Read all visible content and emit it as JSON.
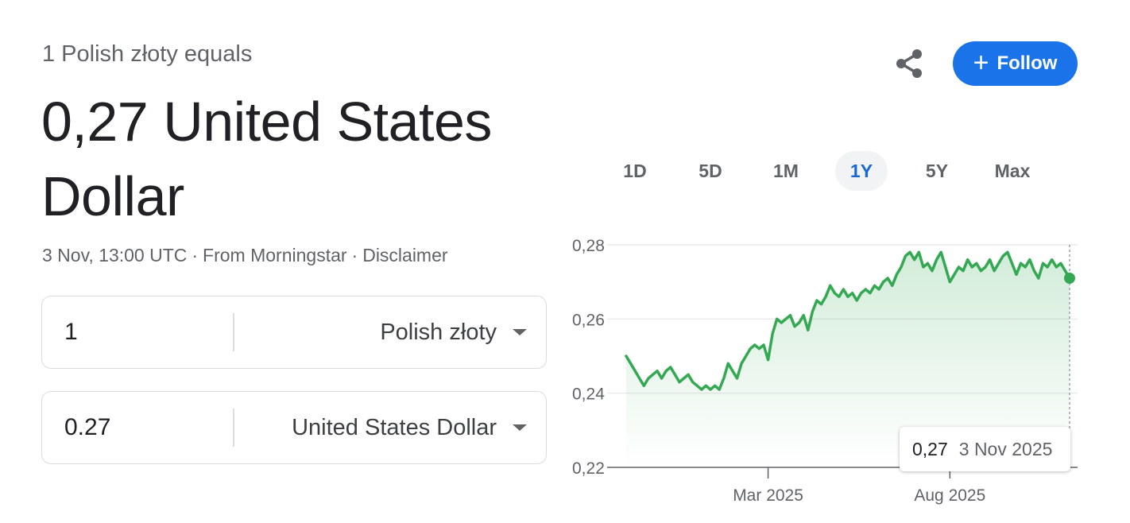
{
  "header": {
    "subtitle": "1 Polish złoty equals",
    "result": "0,27 United States Dollar"
  },
  "meta": {
    "timestamp": "3 Nov, 13:00 UTC",
    "source": "From Morningstar",
    "disclaimer": "Disclaimer",
    "separator": "·"
  },
  "converter": {
    "from": {
      "amount": "1",
      "currency": "Polish złoty"
    },
    "to": {
      "amount": "0.27",
      "currency": "United States Dollar"
    }
  },
  "actions": {
    "share_icon": "share-icon",
    "follow_label": "Follow",
    "follow_plus": "+"
  },
  "ranges": [
    {
      "label": "1D",
      "active": false
    },
    {
      "label": "5D",
      "active": false
    },
    {
      "label": "1M",
      "active": false
    },
    {
      "label": "1Y",
      "active": true
    },
    {
      "label": "5Y",
      "active": false
    },
    {
      "label": "Max",
      "active": false
    }
  ],
  "colors": {
    "line": "#34a853",
    "accent": "#1a73e8",
    "active_range": "#1967d2"
  },
  "tooltip": {
    "value": "0,27",
    "date": "3 Nov 2025"
  },
  "chart_data": {
    "type": "area",
    "title": "",
    "xlabel": "",
    "ylabel": "",
    "ylim": [
      0.22,
      0.28
    ],
    "yticks": [
      "0,28",
      "0,26",
      "0,24",
      "0,22"
    ],
    "xticks": [
      {
        "label": "Mar 2025",
        "t": 0.32
      },
      {
        "label": "Aug 2025",
        "t": 0.73
      }
    ],
    "grid": true,
    "legend": "none",
    "series": [
      {
        "points": [
          [
            0.0,
            0.25
          ],
          [
            0.01,
            0.248
          ],
          [
            0.02,
            0.246
          ],
          [
            0.03,
            0.244
          ],
          [
            0.04,
            0.242
          ],
          [
            0.05,
            0.244
          ],
          [
            0.06,
            0.245
          ],
          [
            0.07,
            0.246
          ],
          [
            0.08,
            0.244
          ],
          [
            0.09,
            0.246
          ],
          [
            0.1,
            0.247
          ],
          [
            0.11,
            0.245
          ],
          [
            0.12,
            0.243
          ],
          [
            0.13,
            0.244
          ],
          [
            0.14,
            0.245
          ],
          [
            0.15,
            0.243
          ],
          [
            0.16,
            0.242
          ],
          [
            0.17,
            0.241
          ],
          [
            0.18,
            0.242
          ],
          [
            0.19,
            0.241
          ],
          [
            0.2,
            0.242
          ],
          [
            0.21,
            0.241
          ],
          [
            0.22,
            0.244
          ],
          [
            0.23,
            0.248
          ],
          [
            0.24,
            0.246
          ],
          [
            0.25,
            0.244
          ],
          [
            0.26,
            0.248
          ],
          [
            0.27,
            0.25
          ],
          [
            0.28,
            0.252
          ],
          [
            0.29,
            0.253
          ],
          [
            0.3,
            0.252
          ],
          [
            0.31,
            0.253
          ],
          [
            0.32,
            0.249
          ],
          [
            0.33,
            0.256
          ],
          [
            0.34,
            0.26
          ],
          [
            0.35,
            0.259
          ],
          [
            0.36,
            0.26
          ],
          [
            0.37,
            0.261
          ],
          [
            0.38,
            0.258
          ],
          [
            0.39,
            0.259
          ],
          [
            0.4,
            0.261
          ],
          [
            0.41,
            0.257
          ],
          [
            0.42,
            0.262
          ],
          [
            0.43,
            0.265
          ],
          [
            0.44,
            0.264
          ],
          [
            0.45,
            0.266
          ],
          [
            0.46,
            0.269
          ],
          [
            0.47,
            0.267
          ],
          [
            0.48,
            0.266
          ],
          [
            0.49,
            0.268
          ],
          [
            0.5,
            0.266
          ],
          [
            0.51,
            0.267
          ],
          [
            0.52,
            0.265
          ],
          [
            0.53,
            0.267
          ],
          [
            0.54,
            0.268
          ],
          [
            0.55,
            0.267
          ],
          [
            0.56,
            0.269
          ],
          [
            0.57,
            0.268
          ],
          [
            0.58,
            0.27
          ],
          [
            0.59,
            0.271
          ],
          [
            0.6,
            0.269
          ],
          [
            0.61,
            0.272
          ],
          [
            0.62,
            0.274
          ],
          [
            0.63,
            0.277
          ],
          [
            0.64,
            0.278
          ],
          [
            0.65,
            0.276
          ],
          [
            0.66,
            0.278
          ],
          [
            0.67,
            0.274
          ],
          [
            0.68,
            0.275
          ],
          [
            0.69,
            0.273
          ],
          [
            0.7,
            0.276
          ],
          [
            0.71,
            0.278
          ],
          [
            0.72,
            0.274
          ],
          [
            0.73,
            0.27
          ],
          [
            0.74,
            0.272
          ],
          [
            0.75,
            0.274
          ],
          [
            0.76,
            0.273
          ],
          [
            0.77,
            0.276
          ],
          [
            0.78,
            0.274
          ],
          [
            0.79,
            0.275
          ],
          [
            0.8,
            0.273
          ],
          [
            0.81,
            0.274
          ],
          [
            0.82,
            0.276
          ],
          [
            0.83,
            0.273
          ],
          [
            0.84,
            0.275
          ],
          [
            0.85,
            0.277
          ],
          [
            0.86,
            0.278
          ],
          [
            0.87,
            0.275
          ],
          [
            0.88,
            0.272
          ],
          [
            0.89,
            0.275
          ],
          [
            0.9,
            0.274
          ],
          [
            0.91,
            0.276
          ],
          [
            0.92,
            0.273
          ],
          [
            0.93,
            0.271
          ],
          [
            0.94,
            0.275
          ],
          [
            0.95,
            0.274
          ],
          [
            0.96,
            0.276
          ],
          [
            0.97,
            0.274
          ],
          [
            0.98,
            0.275
          ],
          [
            0.99,
            0.273
          ],
          [
            1.0,
            0.271
          ]
        ]
      }
    ]
  }
}
